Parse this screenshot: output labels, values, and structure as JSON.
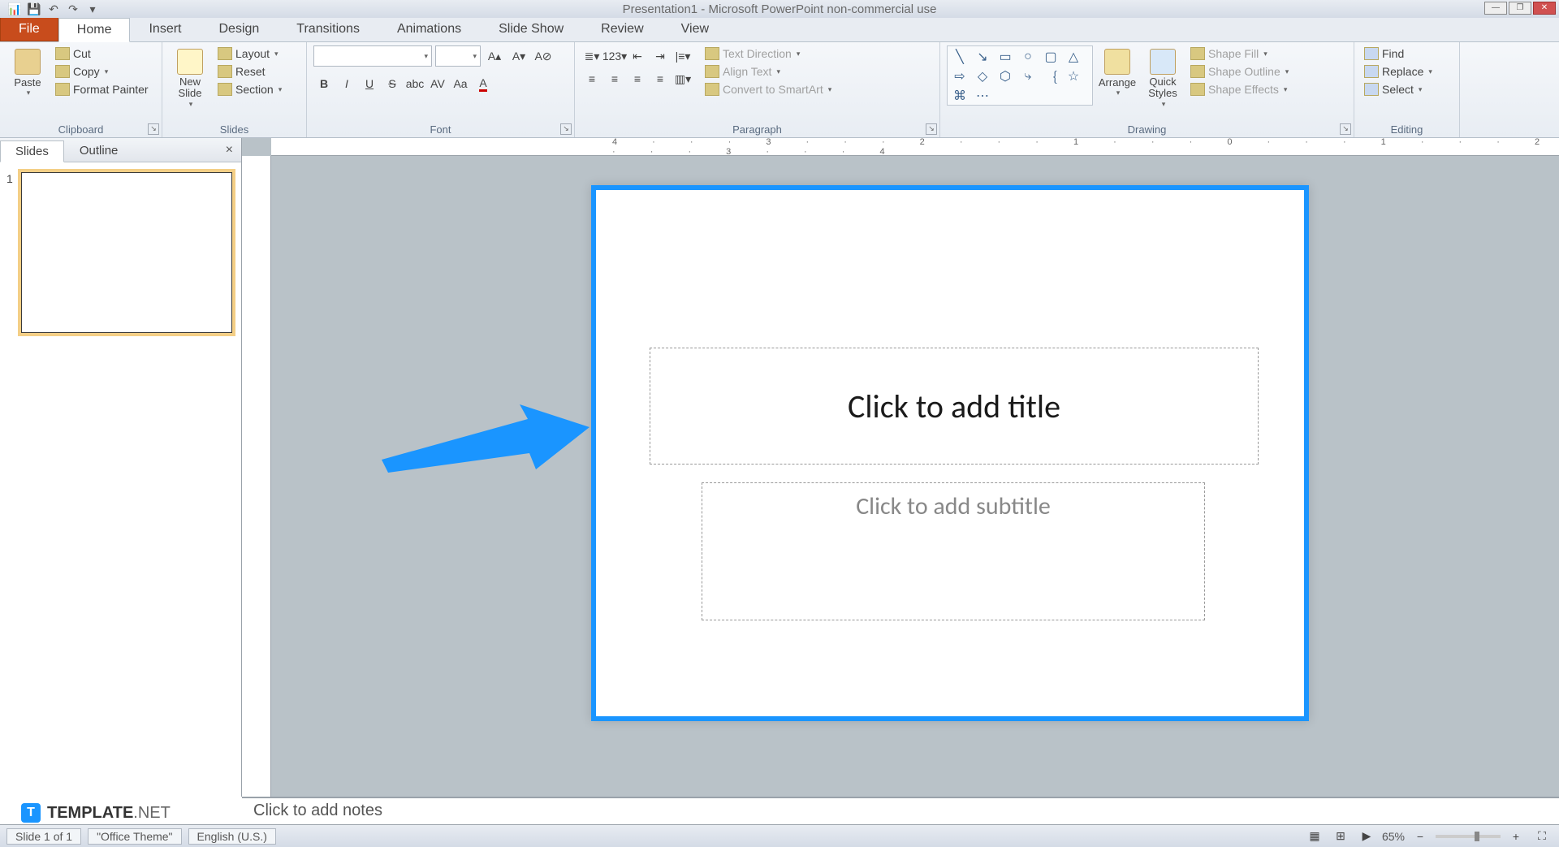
{
  "titlebar": {
    "title": "Presentation1 - Microsoft PowerPoint non-commercial use"
  },
  "tabs": {
    "file": "File",
    "items": [
      "Home",
      "Insert",
      "Design",
      "Transitions",
      "Animations",
      "Slide Show",
      "Review",
      "View"
    ],
    "active": "Home"
  },
  "ribbon": {
    "clipboard": {
      "label": "Clipboard",
      "paste": "Paste",
      "cut": "Cut",
      "copy": "Copy",
      "format_painter": "Format Painter"
    },
    "slides": {
      "label": "Slides",
      "new_slide": "New\nSlide",
      "layout": "Layout",
      "reset": "Reset",
      "section": "Section"
    },
    "font": {
      "label": "Font"
    },
    "paragraph": {
      "label": "Paragraph",
      "text_direction": "Text Direction",
      "align_text": "Align Text",
      "smartart": "Convert to SmartArt"
    },
    "drawing": {
      "label": "Drawing",
      "arrange": "Arrange",
      "quick_styles": "Quick\nStyles",
      "shape_fill": "Shape Fill",
      "shape_outline": "Shape Outline",
      "shape_effects": "Shape Effects"
    },
    "editing": {
      "label": "Editing",
      "find": "Find",
      "replace": "Replace",
      "select": "Select"
    }
  },
  "thumbs": {
    "slides_tab": "Slides",
    "outline_tab": "Outline",
    "num": "1"
  },
  "ruler": {
    "marks": "4 · · · 3 · · · 2 · · · 1 · · · 0 · · · 1 · · · 2 · · · 3 · · · 4"
  },
  "slide": {
    "title_ph": "Click to add title",
    "subtitle_ph": "Click to add subtitle"
  },
  "notes": {
    "placeholder": "Click to add notes"
  },
  "status": {
    "slide": "Slide 1 of 1",
    "theme": "\"Office Theme\"",
    "lang": "English (U.S.)",
    "zoom": "65%"
  },
  "watermark": {
    "brand": "TEMPLATE",
    "suffix": ".NET",
    "badge": "T"
  }
}
